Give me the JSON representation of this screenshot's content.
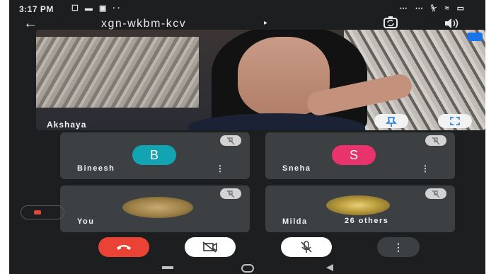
{
  "status_bar": {
    "time": "3:17 PM",
    "left_icons": "☐ ▬ ▣ ··",
    "right_icons": "⋯ ⋯ ⏧ ≈ ▭"
  },
  "header": {
    "meeting_code": "xgn-wkbm-kcv",
    "back_icon": "←",
    "caret_icon": "▸"
  },
  "main_tile": {
    "participant_name": "Akshaya"
  },
  "participants": [
    {
      "name": "Bineesh",
      "initial": "B",
      "avatar_color": "#12a4b3",
      "more": "⋮"
    },
    {
      "name": "Sneha",
      "initial": "S",
      "avatar_color": "#e8336c",
      "more": "⋮"
    },
    {
      "name": "You"
    },
    {
      "name": "Milda",
      "others": "26 others"
    }
  ],
  "controls": {
    "more_label": "⋮"
  },
  "colors": {
    "end_call": "#ea4335",
    "tile_bg": "#3c4043",
    "screen_bg": "#1d1e20"
  }
}
